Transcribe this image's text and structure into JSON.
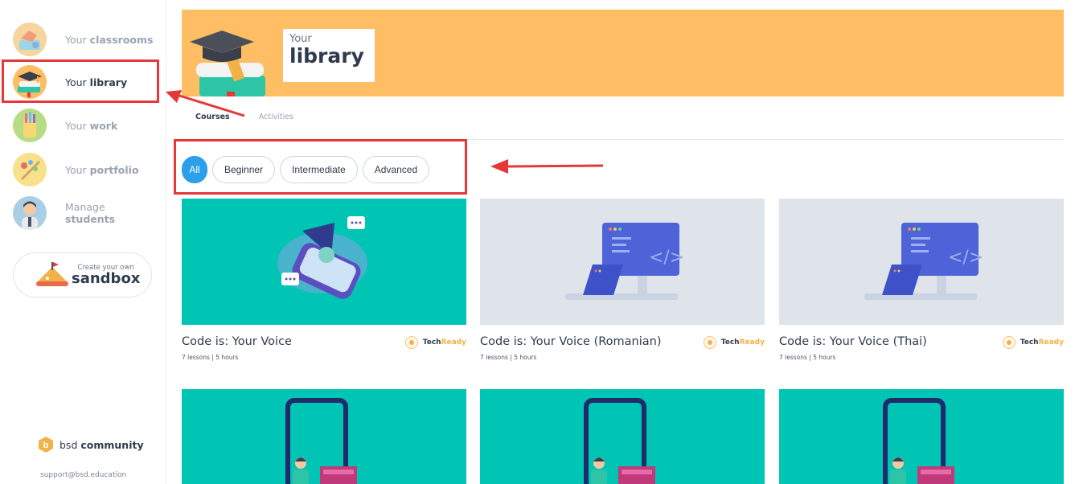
{
  "sidebar": {
    "items": [
      {
        "prefix": "Your ",
        "bold": "classrooms"
      },
      {
        "prefix": "Your ",
        "bold": "library"
      },
      {
        "prefix": "Your ",
        "bold": "work"
      },
      {
        "prefix": "Your ",
        "bold": "portfolio"
      },
      {
        "prefix": "Manage",
        "bold": "students"
      }
    ],
    "sandbox": {
      "small": "Create your own",
      "big": "sandbox"
    },
    "community": {
      "prefix": "bsd ",
      "bold": "community"
    },
    "support_email": "support@bsd.education"
  },
  "banner": {
    "small": "Your",
    "big": "library",
    "color": "#ffbd64"
  },
  "tabs": [
    {
      "label": "Courses",
      "active": true
    },
    {
      "label": "Activities",
      "active": false
    }
  ],
  "filters": [
    "All",
    "Beginner",
    "Intermediate",
    "Advanced"
  ],
  "brand": {
    "tech": "Tech",
    "ready": "Ready"
  },
  "courses": [
    {
      "title": "Code is: Your Voice",
      "meta": "7 lessons | 5 hours"
    },
    {
      "title": "Code is: Your Voice (Romanian)",
      "meta": "7 lessons | 5 hours"
    },
    {
      "title": "Code is: Your Voice (Thai)",
      "meta": "7 lessons | 5 hours"
    }
  ],
  "colors": {
    "accent": "#2d9ee9",
    "teal": "#00c4b4",
    "highlight": "#e53939"
  }
}
